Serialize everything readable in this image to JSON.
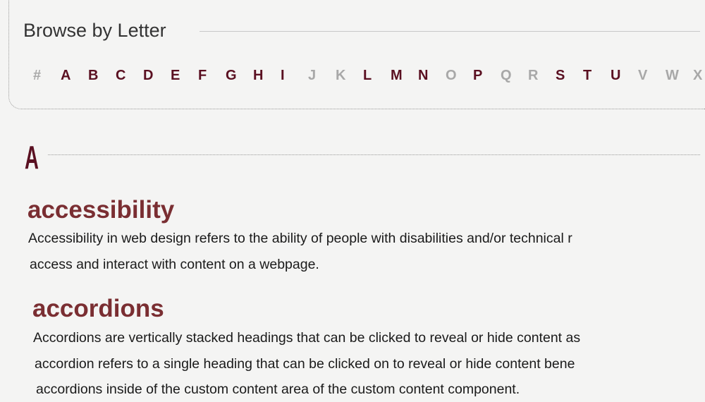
{
  "browse": {
    "title": "Browse by Letter",
    "letters": [
      {
        "label": "#",
        "enabled": false
      },
      {
        "label": "A",
        "enabled": true
      },
      {
        "label": "B",
        "enabled": true
      },
      {
        "label": "C",
        "enabled": true
      },
      {
        "label": "D",
        "enabled": true
      },
      {
        "label": "E",
        "enabled": true
      },
      {
        "label": "F",
        "enabled": true
      },
      {
        "label": "G",
        "enabled": true
      },
      {
        "label": "H",
        "enabled": true
      },
      {
        "label": "I",
        "enabled": true
      },
      {
        "label": "J",
        "enabled": false
      },
      {
        "label": "K",
        "enabled": false
      },
      {
        "label": "L",
        "enabled": true
      },
      {
        "label": "M",
        "enabled": true
      },
      {
        "label": "N",
        "enabled": true
      },
      {
        "label": "O",
        "enabled": false
      },
      {
        "label": "P",
        "enabled": true
      },
      {
        "label": "Q",
        "enabled": false
      },
      {
        "label": "R",
        "enabled": false
      },
      {
        "label": "S",
        "enabled": true
      },
      {
        "label": "T",
        "enabled": true
      },
      {
        "label": "U",
        "enabled": true
      },
      {
        "label": "V",
        "enabled": false
      },
      {
        "label": "W",
        "enabled": false
      },
      {
        "label": "X",
        "enabled": false
      }
    ]
  },
  "section": {
    "letter": "A",
    "terms": [
      {
        "term": "accessibility",
        "lines": [
          "Accessibility in web design refers to the ability of people with disabilities and/or technical r",
          "access and interact with content on a webpage."
        ]
      },
      {
        "term": "accordions",
        "lines": [
          "Accordions are vertically stacked headings that can be clicked to reveal or hide content as",
          "accordion refers to a single heading that can be clicked on to reveal or hide content bene",
          "accordions inside of the custom content area of the custom content component."
        ]
      }
    ]
  },
  "colors": {
    "active_letter": "#5a1021",
    "disabled_letter": "#a8a8a8",
    "term_heading": "#7a2e32",
    "background": "#f4f4f3"
  }
}
